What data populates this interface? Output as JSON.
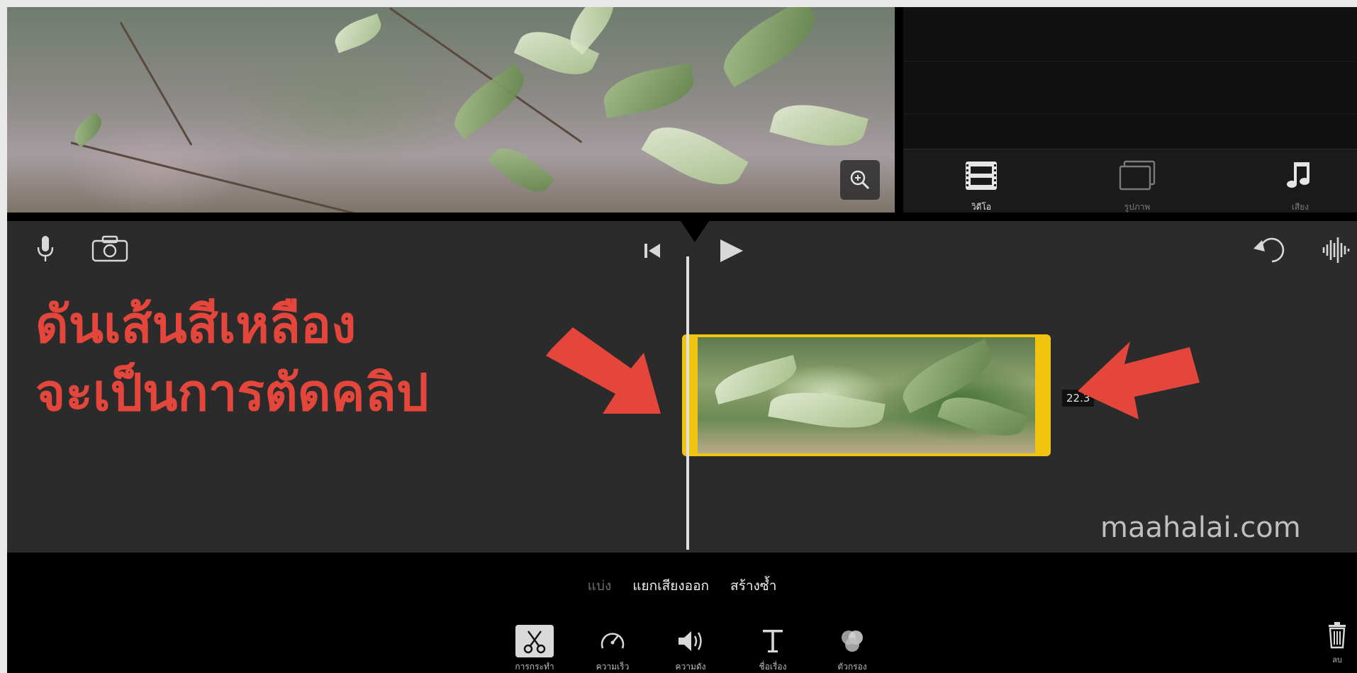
{
  "viewer": {
    "zoom_icon": "magnify-plus-icon"
  },
  "browser": {
    "tabs": [
      {
        "label": "วิดีโอ",
        "icon": "film-icon",
        "active": true
      },
      {
        "label": "รูปภาพ",
        "icon": "photos-icon",
        "active": false
      },
      {
        "label": "เสียง",
        "icon": "music-note-icon",
        "active": false
      }
    ]
  },
  "timeline": {
    "left_icons": [
      "microphone-icon",
      "camera-icon"
    ],
    "transport_icons": [
      "skip-to-start-icon",
      "play-icon"
    ],
    "right_icons": [
      "undo-icon",
      "audio-waveform-icon"
    ],
    "instruction": {
      "line1": "ดันเส้นสีเหลือง",
      "line2": "จะเป็นการตัดคลิป"
    },
    "clip_duration": "22.3",
    "watermark": "maahalai.com",
    "accent_color": "#f1c40f",
    "annotation_color": "#e5463c"
  },
  "toolbar": {
    "actions": [
      {
        "label": "แบ่ง",
        "enabled": false
      },
      {
        "label": "แยกเสียงออก",
        "enabled": true
      },
      {
        "label": "สร้างซ้ำ",
        "enabled": true
      }
    ],
    "tools": [
      {
        "label": "การกระทำ",
        "icon": "scissors-icon",
        "active": true
      },
      {
        "label": "ความเร็ว",
        "icon": "speedometer-icon",
        "active": false
      },
      {
        "label": "ความดัง",
        "icon": "speaker-icon",
        "active": false
      },
      {
        "label": "ชื่อเรื่อง",
        "icon": "title-text-icon",
        "active": false
      },
      {
        "label": "ตัวกรอง",
        "icon": "filter-circles-icon",
        "active": false
      }
    ],
    "delete_label": "ลบ",
    "delete_icon": "trash-icon"
  }
}
